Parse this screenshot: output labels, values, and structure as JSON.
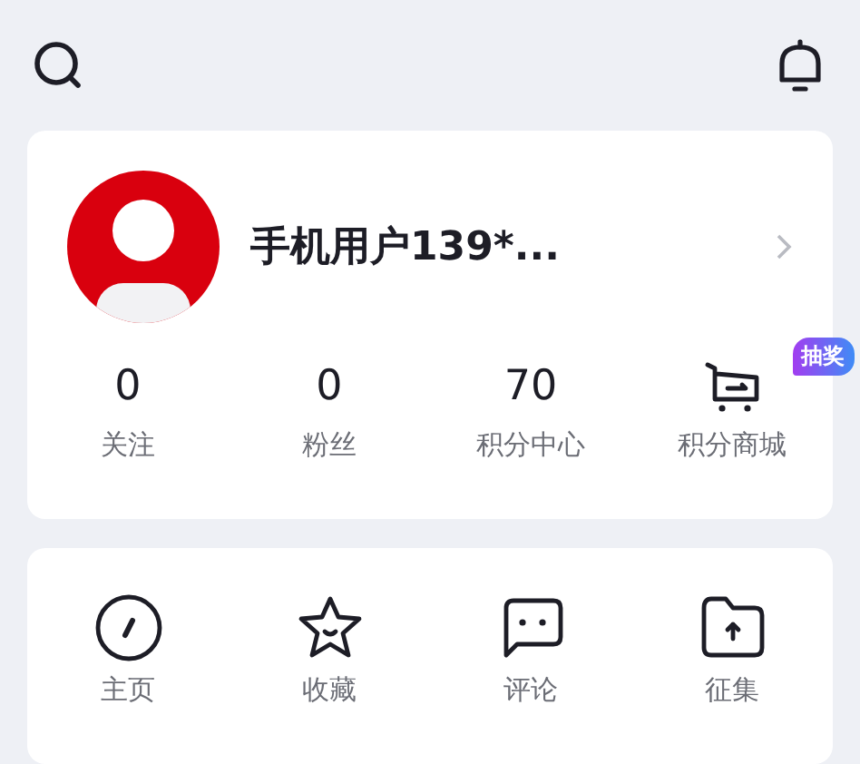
{
  "profile": {
    "name": "手机用户139*..."
  },
  "stats": [
    {
      "kind": "count",
      "value": "0",
      "label": "关注"
    },
    {
      "kind": "count",
      "value": "0",
      "label": "粉丝"
    },
    {
      "kind": "count",
      "value": "70",
      "label": "积分中心"
    },
    {
      "kind": "cart",
      "badge": "抽奖",
      "label": "积分商城"
    }
  ],
  "shortcuts": [
    {
      "kind": "compass",
      "label": "主页"
    },
    {
      "kind": "star",
      "label": "收藏"
    },
    {
      "kind": "chat",
      "label": "评论"
    },
    {
      "kind": "folder",
      "label": "征集"
    }
  ]
}
